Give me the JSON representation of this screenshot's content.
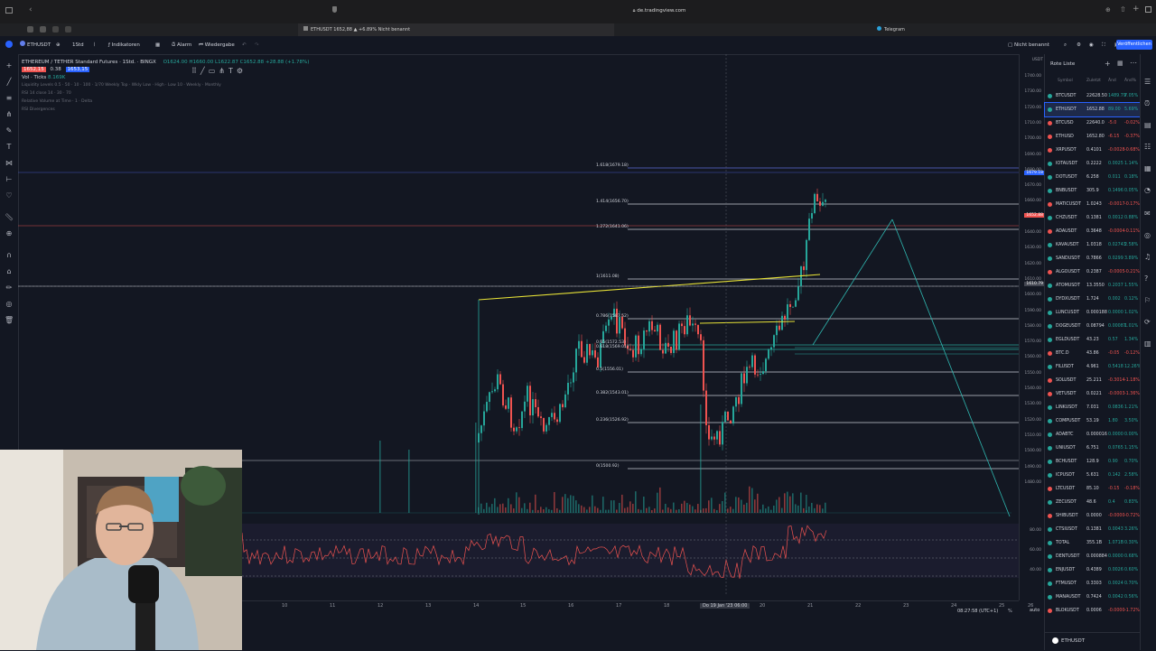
{
  "browser": {
    "url": "de.tradingview.com",
    "tab_active": "ETHUSDT 1652,88 ▲ +6.89% Nicht benannt",
    "tab_other": "Telegram"
  },
  "toolbar": {
    "symbol": "ETHUSDT",
    "interval": "1Std",
    "indicators": "Indikatoren",
    "alarm": "Alarm",
    "replay": "Wiedergabe",
    "layout_name": "Nicht benannt",
    "publish": "Veröffentlichen"
  },
  "legend": {
    "title": "ETHEREUM / TETHER Standard Futures · 1Std. · BINGX",
    "ohlc": "O1624.00 H1660.00 L1622.87 C1652.88 +28.88 (+1.78%)",
    "price_sell": "1652,15",
    "spread": "0.38",
    "price_buy": "1653,15",
    "vol_ticks": "Vol · Ticks",
    "vol_value": "8.169K",
    "line3": "Liquidity Levels 0.5 · 50 · 10 · 100 · 1/70 Weekly Top · Wkly Low · High · Low 10 · Weekly · Monthly",
    "line4": "RSI 14 close 14 · 30 · 70",
    "line5": "Relative Volume at Time · 1 · Delta",
    "line6": "RSI Divergences"
  },
  "fib_levels": [
    {
      "label": "1.618(1679.18)"
    },
    {
      "label": "1.414(1656.70)"
    },
    {
      "label": "1.272(1641.06)"
    },
    {
      "label": "1(1611.08)"
    },
    {
      "label": "0.786(1587.52)"
    },
    {
      "label": "0.65(1572.53)"
    },
    {
      "label": "0.618(1569.01)"
    },
    {
      "label": "0.5(1556.01)"
    },
    {
      "label": "0.382(1543.01)"
    },
    {
      "label": "0.236(1526.92)"
    },
    {
      "label": "0(1500.92)"
    }
  ],
  "price_axis": {
    "ticks": [
      "1740.00",
      "1730.00",
      "1720.00",
      "1710.00",
      "1700.00",
      "1690.00",
      "1680.00",
      "1670.00",
      "1660.00",
      "1650.00",
      "1640.00",
      "1630.00",
      "1620.00",
      "1610.00",
      "1600.00",
      "1590.00",
      "1580.00",
      "1570.00",
      "1560.00",
      "1550.00",
      "1540.00",
      "1530.00",
      "1520.00",
      "1510.00",
      "1500.00",
      "1490.00",
      "1480.00"
    ],
    "currency": "USDT",
    "tag_fib": "1679.18",
    "tag_price": "1652.88",
    "tag_level": "1610.79",
    "rsi_ticks": [
      "80.00",
      "60.00",
      "40.00"
    ]
  },
  "time_axis": {
    "labels": [
      "10",
      "11",
      "12",
      "13",
      "14",
      "15",
      "16",
      "17",
      "18",
      "Do 19 Jan '23  06:00",
      "20",
      "21",
      "22",
      "23",
      "24",
      "25",
      "26"
    ],
    "clock": "08:27:58 (UTC+1)",
    "log": "%",
    "auto": "auto"
  },
  "watchlist": {
    "title": "Rote Liste",
    "columns": [
      "Symbol",
      "Zuletzt",
      "Änd",
      "Änd%"
    ],
    "rows": [
      {
        "symbol": "BTCUSDT",
        "last": "22628.50",
        "chg": "1489.79",
        "pct": "7.05%",
        "dir": "up"
      },
      {
        "symbol": "ETHUSDT",
        "last": "1652.88",
        "chg": "89.00",
        "pct": "5.69%",
        "dir": "up",
        "selected": true
      },
      {
        "symbol": "BTCUSD",
        "last": "22640.0",
        "chg": "-5.0",
        "pct": "-0.02%",
        "dir": "down"
      },
      {
        "symbol": "ETHUSD",
        "last": "1652.80",
        "chg": "-6.15",
        "pct": "-0.37%",
        "dir": "down"
      },
      {
        "symbol": "XRPUSDT",
        "last": "0.4101",
        "chg": "-0.0028",
        "pct": "-0.68%",
        "dir": "down"
      },
      {
        "symbol": "IOTAUSDT",
        "last": "0.2222",
        "chg": "0.0025",
        "pct": "1.14%",
        "dir": "up"
      },
      {
        "symbol": "DOTUSDT",
        "last": "6.258",
        "chg": "0.011",
        "pct": "0.18%",
        "dir": "up"
      },
      {
        "symbol": "BNBUSDT",
        "last": "305.9",
        "chg": "0.1496",
        "pct": "0.05%",
        "dir": "up"
      },
      {
        "symbol": "MATICUSDT",
        "last": "1.0243",
        "chg": "-0.0017",
        "pct": "-0.17%",
        "dir": "down"
      },
      {
        "symbol": "CHZUSDT",
        "last": "0.1381",
        "chg": "0.0012",
        "pct": "0.88%",
        "dir": "up"
      },
      {
        "symbol": "ADAUSDT",
        "last": "0.3648",
        "chg": "-0.0004",
        "pct": "-0.11%",
        "dir": "down"
      },
      {
        "symbol": "KAVAUSDT",
        "last": "1.0318",
        "chg": "0.02743",
        "pct": "2.58%",
        "dir": "up"
      },
      {
        "symbol": "SANDUSDT",
        "last": "0.7866",
        "chg": "0.0299",
        "pct": "3.89%",
        "dir": "up"
      },
      {
        "symbol": "ALGOUSDT",
        "last": "0.2387",
        "chg": "-0.0005",
        "pct": "-0.21%",
        "dir": "down"
      },
      {
        "symbol": "ATOMUSDT",
        "last": "13.3550",
        "chg": "0.2037",
        "pct": "1.55%",
        "dir": "up"
      },
      {
        "symbol": "DYDXUSDT",
        "last": "1.724",
        "chg": "0.002",
        "pct": "0.12%",
        "dir": "up"
      },
      {
        "symbol": "LUNCUSDT",
        "last": "0.000188",
        "chg": "0.0000",
        "pct": "1.02%",
        "dir": "up"
      },
      {
        "symbol": "DOGEUSDT",
        "last": "0.08794",
        "chg": "0.00087",
        "pct": "1.01%",
        "dir": "up"
      },
      {
        "symbol": "EGLDUSDT",
        "last": "43.23",
        "chg": "0.57",
        "pct": "1.34%",
        "dir": "up"
      },
      {
        "symbol": "BTC.D",
        "last": "43.86",
        "chg": "-0.05",
        "pct": "-0.12%",
        "dir": "down"
      },
      {
        "symbol": "FILUSDT",
        "last": "4.961",
        "chg": "0.5418",
        "pct": "12.26%",
        "dir": "up"
      },
      {
        "symbol": "SOLUSDT",
        "last": "25.211",
        "chg": "-0.3014",
        "pct": "-1.18%",
        "dir": "down"
      },
      {
        "symbol": "VETUSDT",
        "last": "0.0221",
        "chg": "-0.0003",
        "pct": "-1.36%",
        "dir": "down"
      },
      {
        "symbol": "LINKUSDT",
        "last": "7.031",
        "chg": "0.0836",
        "pct": "1.21%",
        "dir": "up"
      },
      {
        "symbol": "COMPUSDT",
        "last": "53.19",
        "chg": "1.80",
        "pct": "3.50%",
        "dir": "up"
      },
      {
        "symbol": "ADABTC",
        "last": "0.000016",
        "chg": "0.0000",
        "pct": "0.00%",
        "dir": "up"
      },
      {
        "symbol": "UNIUSDT",
        "last": "6.751",
        "chg": "0.0765",
        "pct": "1.15%",
        "dir": "up"
      },
      {
        "symbol": "BCHUSDT",
        "last": "128.9",
        "chg": "0.90",
        "pct": "0.70%",
        "dir": "up"
      },
      {
        "symbol": "ICPUSDT",
        "last": "5.631",
        "chg": "0.142",
        "pct": "2.58%",
        "dir": "up"
      },
      {
        "symbol": "LTCUSDT",
        "last": "85.10",
        "chg": "-0.15",
        "pct": "-0.18%",
        "dir": "down"
      },
      {
        "symbol": "ZECUSDT",
        "last": "48.6",
        "chg": "0.4",
        "pct": "0.83%",
        "dir": "up"
      },
      {
        "symbol": "SHIBUSDT",
        "last": "0.0000",
        "chg": "-0.0000",
        "pct": "-0.72%",
        "dir": "down"
      },
      {
        "symbol": "CTSIUSDT",
        "last": "0.1381",
        "chg": "0.0043",
        "pct": "3.26%",
        "dir": "up"
      },
      {
        "symbol": "TOTAL",
        "last": "355.1B",
        "chg": "1.071B",
        "pct": "0.30%",
        "dir": "up"
      },
      {
        "symbol": "DENTUSDT",
        "last": "0.000884",
        "chg": "0.0000",
        "pct": "0.68%",
        "dir": "up"
      },
      {
        "symbol": "ENJUSDT",
        "last": "0.4389",
        "chg": "0.0026",
        "pct": "0.60%",
        "dir": "up"
      },
      {
        "symbol": "FTMUSDT",
        "last": "0.3303",
        "chg": "0.0024",
        "pct": "0.70%",
        "dir": "up"
      },
      {
        "symbol": "MANAUSDT",
        "last": "0.7424",
        "chg": "0.0042",
        "pct": "0.56%",
        "dir": "up"
      },
      {
        "symbol": "BLOKUSDT",
        "last": "0.0006",
        "chg": "-0.0000",
        "pct": "-1.72%",
        "dir": "down"
      }
    ],
    "footer_symbol": "ETHUSDT"
  },
  "colors": {
    "up": "#26a69a",
    "down": "#ef5350",
    "accent": "#2962ff",
    "trendline": "#e8e337",
    "fib": "#d1d4dc",
    "projection": "#2fb7b0"
  }
}
